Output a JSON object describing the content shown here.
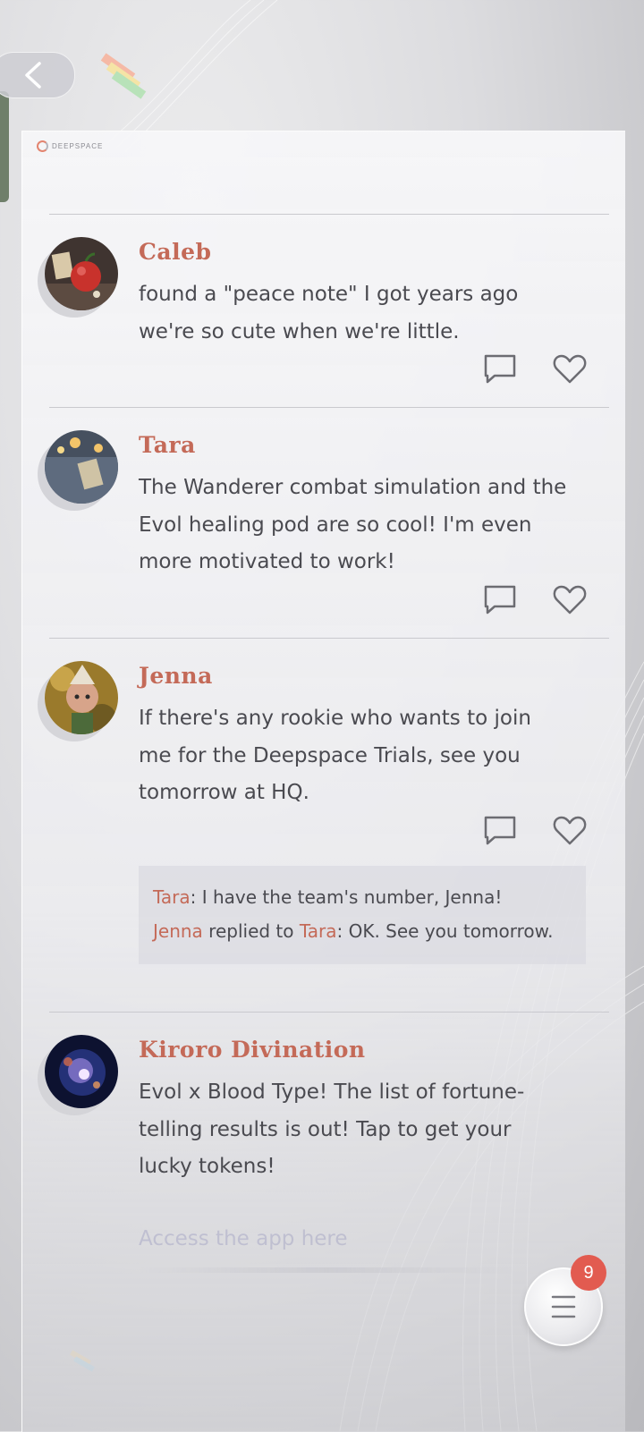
{
  "app": {
    "brand": "DEEPSPACE"
  },
  "navigation": {
    "back_icon": "chevron-left-icon"
  },
  "posts": [
    {
      "author": "Caleb",
      "text": "found a \"peace note\" I got years ago we're so cute when we're little.",
      "avatar": "apple-on-table-photo"
    },
    {
      "author": "Tara",
      "text": "The Wanderer combat simulation and the Evol healing pod are so cool! I'm even more motivated to work!",
      "avatar": "card-and-candles-photo"
    },
    {
      "author": "Jenna",
      "text": "If there's any rookie who wants to join me for the Deepspace Trials, see you tomorrow at HQ.",
      "avatar": "figurine-photo",
      "replies": {
        "r1_name": "Tara",
        "r1_text": ": I have the team's number, Jenna!",
        "r2_name": "Jenna",
        "r2_mid": " replied to ",
        "r2_target": "Tara",
        "r2_text": ": OK. See you tomorrow."
      }
    },
    {
      "author": "Kiroro  Divination",
      "text": "Evol x Blood Type! The list of fortune-telling results is out! Tap to get your lucky tokens!",
      "avatar": "galaxy-image",
      "link_text": "Access the app here"
    }
  ],
  "menu": {
    "badge_count": "9",
    "icon": "menu-lines-icon"
  },
  "colors": {
    "accent": "#c46a58",
    "text": "#4a4a50",
    "badge": "#e25b50"
  }
}
